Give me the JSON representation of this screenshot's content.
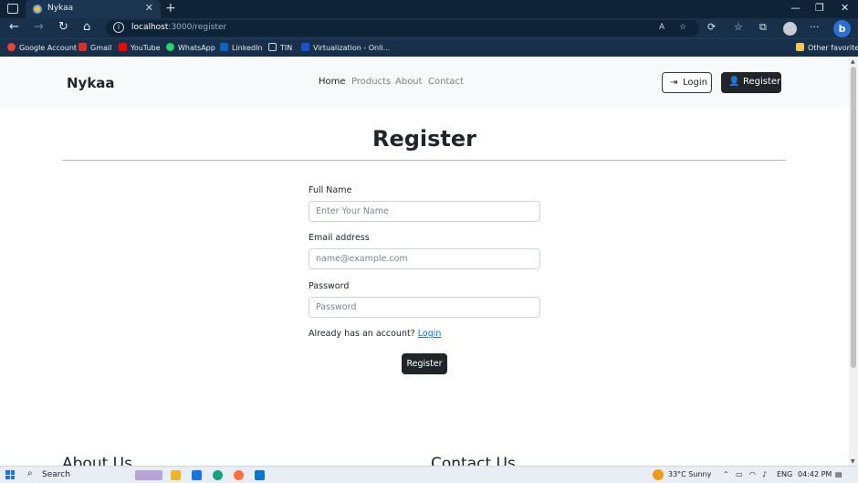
{
  "browser": {
    "tab_title": "Nykaa",
    "tab_close": "✕",
    "new_tab": "+",
    "url_host": "localhost",
    "url_rest": ":3000/register",
    "window_controls": [
      "—",
      "❐",
      "✕"
    ],
    "bookmarks": [
      {
        "label": "Google Account",
        "color": "#ea4335"
      },
      {
        "label": "Gmail",
        "color": "#d93025"
      },
      {
        "label": "YouTube",
        "color": "#ff0000"
      },
      {
        "label": "WhatsApp",
        "color": "#25d366"
      },
      {
        "label": "LinkedIn",
        "color": "#0a66c2"
      },
      {
        "label": "TIN",
        "color": "#9aa6b2"
      },
      {
        "label": "Virtualization - Onli...",
        "color": "#1d4ed8"
      }
    ],
    "other_favorites": "Other favorites"
  },
  "site": {
    "brand": "Nykaa",
    "nav": {
      "home": "Home",
      "products": "Products",
      "about": "About",
      "contact": "Contact"
    },
    "login_button": "Login",
    "register_button": "Register"
  },
  "form": {
    "title": "Register",
    "full_name_label": "Full Name",
    "full_name_placeholder": "Enter Your Name",
    "email_label": "Email address",
    "email_placeholder": "name@example.com",
    "password_label": "Password",
    "password_placeholder": "Password",
    "already_text": "Already has an account?",
    "login_link": "Login",
    "submit_label": "Register"
  },
  "footer": {
    "about_heading": "About Us",
    "contact_heading": "Contact Us"
  },
  "taskbar": {
    "search_label": "Search",
    "weather": "33°C  Sunny",
    "language": "ENG",
    "time": "04:42 PM"
  }
}
